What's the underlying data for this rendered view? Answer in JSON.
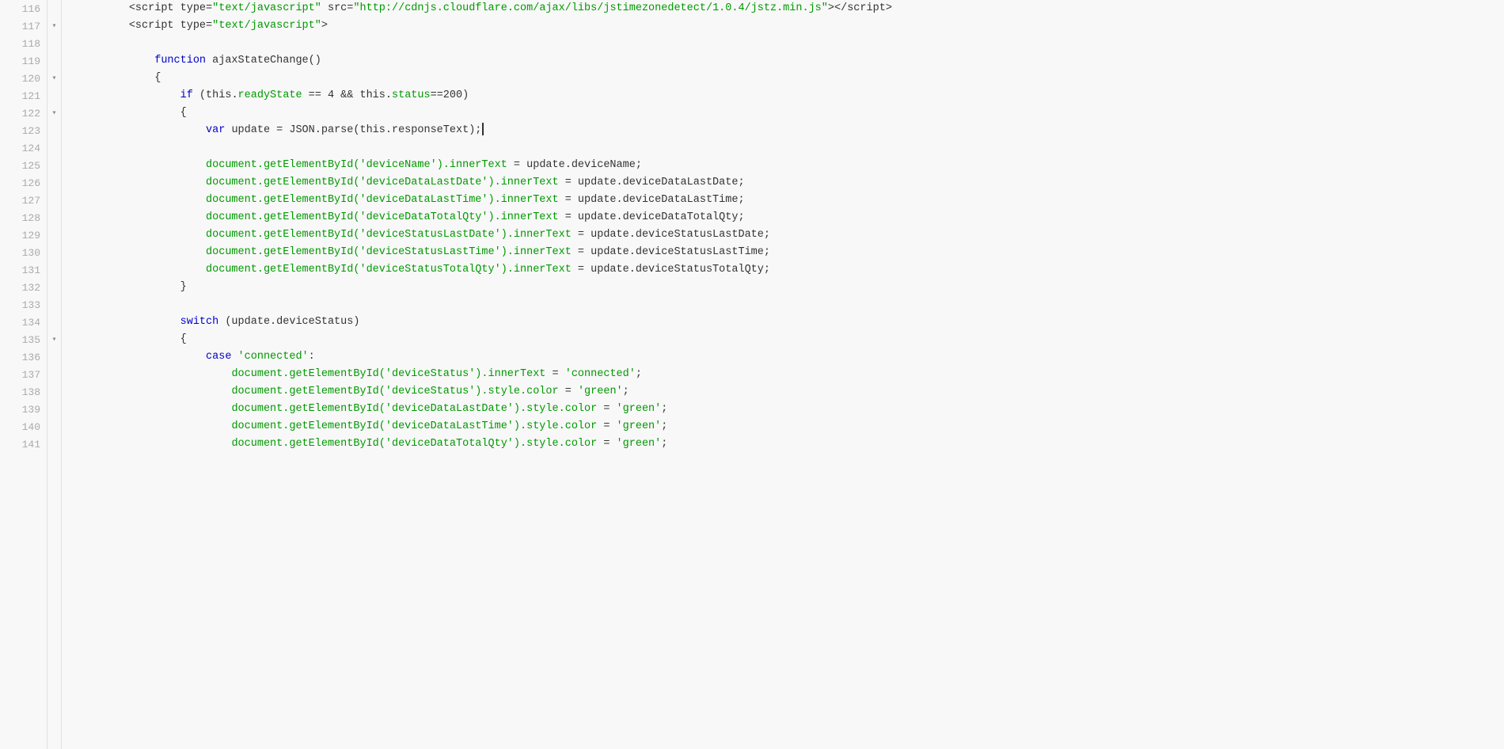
{
  "editor": {
    "background": "#f8f8f8",
    "lines": [
      {
        "num": 116,
        "fold": false,
        "indent": 1,
        "tokens": [
          {
            "type": "plain",
            "text": "        "
          },
          {
            "type": "punct",
            "text": "<"
          },
          {
            "type": "plain",
            "text": "script type="
          },
          {
            "type": "str",
            "text": "\"text/javascript\""
          },
          {
            "type": "plain",
            "text": " src="
          },
          {
            "type": "str",
            "text": "\"http://cdnjs.cloudflare.com/ajax/libs/jstimezonedetect/1.0.4/jstz.min.js\""
          },
          {
            "type": "plain",
            "text": ">"
          },
          {
            "type": "punct",
            "text": "</"
          },
          {
            "type": "plain",
            "text": "script"
          },
          {
            "type": "punct",
            "text": ">"
          }
        ]
      },
      {
        "num": 117,
        "fold": true,
        "indent": 1,
        "tokens": [
          {
            "type": "plain",
            "text": "        "
          },
          {
            "type": "punct",
            "text": "<"
          },
          {
            "type": "plain",
            "text": "script type="
          },
          {
            "type": "str",
            "text": "\"text/javascript\""
          },
          {
            "type": "punct",
            "text": ">"
          }
        ]
      },
      {
        "num": 118,
        "fold": false,
        "empty": true,
        "tokens": []
      },
      {
        "num": 119,
        "fold": false,
        "tokens": [
          {
            "type": "plain",
            "text": "            "
          },
          {
            "type": "kw",
            "text": "function"
          },
          {
            "type": "plain",
            "text": " ajaxStateChange()"
          }
        ]
      },
      {
        "num": 120,
        "fold": true,
        "tokens": [
          {
            "type": "plain",
            "text": "            "
          },
          {
            "type": "punct",
            "text": "{"
          }
        ]
      },
      {
        "num": 121,
        "fold": false,
        "tokens": [
          {
            "type": "plain",
            "text": "                "
          },
          {
            "type": "kw",
            "text": "if"
          },
          {
            "type": "plain",
            "text": " ("
          },
          {
            "type": "plain",
            "text": "this"
          },
          {
            "type": "punct",
            "text": "."
          },
          {
            "type": "dom",
            "text": "readyState"
          },
          {
            "type": "plain",
            "text": " == 4 && "
          },
          {
            "type": "plain",
            "text": "this"
          },
          {
            "type": "punct",
            "text": "."
          },
          {
            "type": "dom",
            "text": "status"
          },
          {
            "type": "plain",
            "text": "==200)"
          }
        ]
      },
      {
        "num": 122,
        "fold": true,
        "tokens": [
          {
            "type": "plain",
            "text": "                "
          },
          {
            "type": "punct",
            "text": "{"
          }
        ]
      },
      {
        "num": 123,
        "fold": false,
        "hasCursor": true,
        "tokens": [
          {
            "type": "plain",
            "text": "                    "
          },
          {
            "type": "kw",
            "text": "var"
          },
          {
            "type": "plain",
            "text": " update = JSON.parse(this.responseText);"
          }
        ]
      },
      {
        "num": 124,
        "fold": false,
        "empty": true,
        "tokens": []
      },
      {
        "num": 125,
        "fold": false,
        "tokens": [
          {
            "type": "plain",
            "text": "                    "
          },
          {
            "type": "dom",
            "text": "document.getElementById("
          },
          {
            "type": "str",
            "text": "'deviceName'"
          },
          {
            "type": "dom",
            "text": ").innerText"
          },
          {
            "type": "plain",
            "text": " = update.deviceName;"
          }
        ]
      },
      {
        "num": 126,
        "fold": false,
        "tokens": [
          {
            "type": "plain",
            "text": "                    "
          },
          {
            "type": "dom",
            "text": "document.getElementById("
          },
          {
            "type": "str",
            "text": "'deviceDataLastDate'"
          },
          {
            "type": "dom",
            "text": ").innerText"
          },
          {
            "type": "plain",
            "text": " = update.deviceDataLastDate;"
          }
        ]
      },
      {
        "num": 127,
        "fold": false,
        "tokens": [
          {
            "type": "plain",
            "text": "                    "
          },
          {
            "type": "dom",
            "text": "document.getElementById("
          },
          {
            "type": "str",
            "text": "'deviceDataLastTime'"
          },
          {
            "type": "dom",
            "text": ").innerText"
          },
          {
            "type": "plain",
            "text": " = update.deviceDataLastTime;"
          }
        ]
      },
      {
        "num": 128,
        "fold": false,
        "tokens": [
          {
            "type": "plain",
            "text": "                    "
          },
          {
            "type": "dom",
            "text": "document.getElementById("
          },
          {
            "type": "str",
            "text": "'deviceDataTotalQty'"
          },
          {
            "type": "dom",
            "text": ").innerText"
          },
          {
            "type": "plain",
            "text": " = update.deviceDataTotalQty;"
          }
        ]
      },
      {
        "num": 129,
        "fold": false,
        "tokens": [
          {
            "type": "plain",
            "text": "                    "
          },
          {
            "type": "dom",
            "text": "document.getElementById("
          },
          {
            "type": "str",
            "text": "'deviceStatusLastDate'"
          },
          {
            "type": "dom",
            "text": ").innerText"
          },
          {
            "type": "plain",
            "text": " = update.deviceStatusLastDate;"
          }
        ]
      },
      {
        "num": 130,
        "fold": false,
        "tokens": [
          {
            "type": "plain",
            "text": "                    "
          },
          {
            "type": "dom",
            "text": "document.getElementById("
          },
          {
            "type": "str",
            "text": "'deviceStatusLastTime'"
          },
          {
            "type": "dom",
            "text": ").innerText"
          },
          {
            "type": "plain",
            "text": " = update.deviceStatusLastTime;"
          }
        ]
      },
      {
        "num": 131,
        "fold": false,
        "tokens": [
          {
            "type": "plain",
            "text": "                    "
          },
          {
            "type": "dom",
            "text": "document.getElementById("
          },
          {
            "type": "str",
            "text": "'deviceStatusTotalQty'"
          },
          {
            "type": "dom",
            "text": ").innerText"
          },
          {
            "type": "plain",
            "text": " = update.deviceStatusTotalQty;"
          }
        ]
      },
      {
        "num": 132,
        "fold": false,
        "tokens": [
          {
            "type": "plain",
            "text": "                "
          },
          {
            "type": "punct",
            "text": "}"
          }
        ]
      },
      {
        "num": 133,
        "fold": false,
        "empty": true,
        "tokens": []
      },
      {
        "num": 134,
        "fold": false,
        "tokens": [
          {
            "type": "plain",
            "text": "                "
          },
          {
            "type": "kw",
            "text": "switch"
          },
          {
            "type": "plain",
            "text": " (update.deviceStatus)"
          }
        ]
      },
      {
        "num": 135,
        "fold": true,
        "tokens": [
          {
            "type": "plain",
            "text": "                "
          },
          {
            "type": "punct",
            "text": "{"
          }
        ]
      },
      {
        "num": 136,
        "fold": false,
        "tokens": [
          {
            "type": "plain",
            "text": "                    "
          },
          {
            "type": "kw",
            "text": "case"
          },
          {
            "type": "plain",
            "text": " "
          },
          {
            "type": "str",
            "text": "'connected'"
          },
          {
            "type": "plain",
            "text": ":"
          }
        ]
      },
      {
        "num": 137,
        "fold": false,
        "tokens": [
          {
            "type": "plain",
            "text": "                        "
          },
          {
            "type": "dom",
            "text": "document.getElementById("
          },
          {
            "type": "str",
            "text": "'deviceStatus'"
          },
          {
            "type": "dom",
            "text": ").innerText"
          },
          {
            "type": "plain",
            "text": " = "
          },
          {
            "type": "str",
            "text": "'connected'"
          },
          {
            "type": "plain",
            "text": ";"
          }
        ]
      },
      {
        "num": 138,
        "fold": false,
        "tokens": [
          {
            "type": "plain",
            "text": "                        "
          },
          {
            "type": "dom",
            "text": "document.getElementById("
          },
          {
            "type": "str",
            "text": "'deviceStatus'"
          },
          {
            "type": "dom",
            "text": ").style.color"
          },
          {
            "type": "plain",
            "text": " = "
          },
          {
            "type": "str",
            "text": "'green'"
          },
          {
            "type": "plain",
            "text": ";"
          }
        ]
      },
      {
        "num": 139,
        "fold": false,
        "tokens": [
          {
            "type": "plain",
            "text": "                        "
          },
          {
            "type": "dom",
            "text": "document.getElementById("
          },
          {
            "type": "str",
            "text": "'deviceDataLastDate'"
          },
          {
            "type": "dom",
            "text": ").style.color"
          },
          {
            "type": "plain",
            "text": " = "
          },
          {
            "type": "str",
            "text": "'green'"
          },
          {
            "type": "plain",
            "text": ";"
          }
        ]
      },
      {
        "num": 140,
        "fold": false,
        "tokens": [
          {
            "type": "plain",
            "text": "                        "
          },
          {
            "type": "dom",
            "text": "document.getElementById("
          },
          {
            "type": "str",
            "text": "'deviceDataLastTime'"
          },
          {
            "type": "dom",
            "text": ").style.color"
          },
          {
            "type": "plain",
            "text": " = "
          },
          {
            "type": "str",
            "text": "'green'"
          },
          {
            "type": "plain",
            "text": ";"
          }
        ]
      },
      {
        "num": 141,
        "fold": false,
        "tokens": [
          {
            "type": "plain",
            "text": "                        "
          },
          {
            "type": "dom",
            "text": "document.getElementById("
          },
          {
            "type": "str",
            "text": "'deviceDataTotalQty'"
          },
          {
            "type": "dom",
            "text": ").style.color"
          },
          {
            "type": "plain",
            "text": " = "
          },
          {
            "type": "str",
            "text": "'green'"
          },
          {
            "type": "plain",
            "text": ";"
          }
        ]
      }
    ]
  }
}
